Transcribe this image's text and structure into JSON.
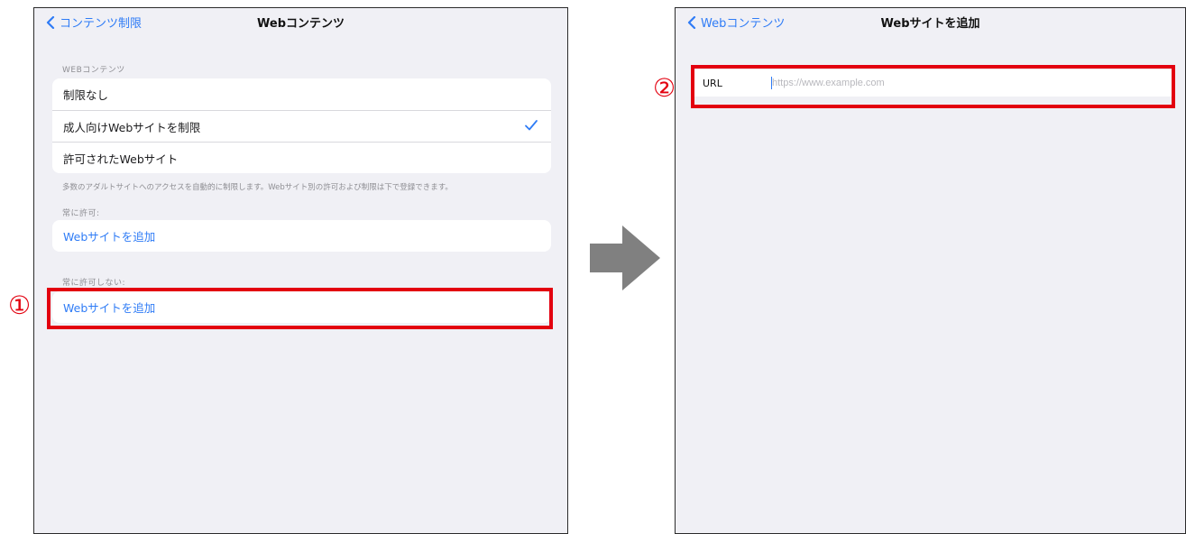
{
  "left_screen": {
    "nav": {
      "back_label": "コンテンツ制限",
      "title": "Webコンテンツ"
    },
    "web_content_header": "WEBコンテンツ",
    "options": [
      {
        "label": "制限なし",
        "selected": false
      },
      {
        "label": "成人向けWebサイトを制限",
        "selected": true
      },
      {
        "label": "許可されたWebサイト",
        "selected": false
      }
    ],
    "footer": "多数のアダルトサイトへのアクセスを自動的に制限します。Webサイト別の許可および制限は下で登録できます。",
    "always_allow": {
      "header": "常に許可:",
      "add_label": "Webサイトを追加"
    },
    "never_allow": {
      "header": "常に許可しない:",
      "add_label": "Webサイトを追加"
    },
    "step_label": "①"
  },
  "right_screen": {
    "nav": {
      "back_label": "Webコンテンツ",
      "title": "Webサイトを追加"
    },
    "url_label": "URL",
    "url_value": "",
    "url_placeholder": "https://www.example.com",
    "step_label": "②"
  },
  "colors": {
    "accent": "#2f7cf6",
    "highlight": "#e3000f",
    "arrow": "#808080",
    "background": "#f0f0f5"
  }
}
